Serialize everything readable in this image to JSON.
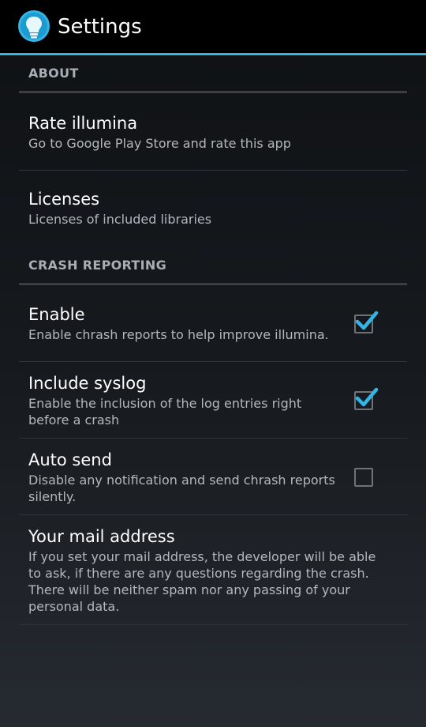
{
  "action_bar": {
    "title": "Settings",
    "app_icon": "lightbulb-icon",
    "accent_color": "#33b5e5"
  },
  "categories": [
    {
      "label": "ABOUT",
      "items": [
        {
          "title": "Rate illumina",
          "summary": "Go to Google Play Store and rate this app"
        },
        {
          "title": "Licenses",
          "summary": "Licenses of included libraries"
        }
      ]
    },
    {
      "label": "CRASH REPORTING",
      "items": [
        {
          "title": "Enable",
          "summary": "Enable chrash reports to help improve illumina.",
          "checked": true
        },
        {
          "title": "Include syslog",
          "summary": "Enable the inclusion of the log entries right before a crash",
          "checked": true
        },
        {
          "title": "Auto send",
          "summary": "Disable any notification and send chrash reports silently.",
          "checked": false
        },
        {
          "title": "Your mail address",
          "summary": "If you set your mail address, the developer will be able to ask, if there are any questions regarding the crash. There will be neither spam nor any passing of your personal data."
        }
      ]
    }
  ]
}
